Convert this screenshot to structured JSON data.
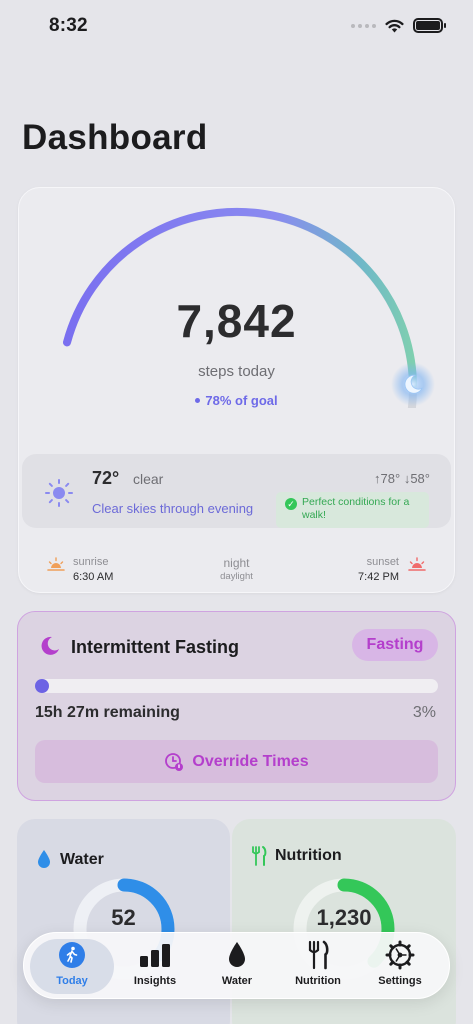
{
  "status_bar": {
    "time": "8:32"
  },
  "page": {
    "title": "Dashboard"
  },
  "steps": {
    "value": "7,842",
    "label": "steps today",
    "goal_text": "78% of goal",
    "goal_fraction": 0.78
  },
  "weather": {
    "temp": "72°",
    "condition": "clear",
    "high": "↑78°",
    "low": "↓58°",
    "forecast": "Clear skies through evening",
    "walk_badge": "Perfect conditions for a walk!"
  },
  "sun": {
    "sunrise_label": "sunrise",
    "sunrise_time": "6:30 AM",
    "mid_label": "night",
    "mid_sub": "daylight",
    "sunset_label": "sunset",
    "sunset_time": "7:42 PM"
  },
  "fasting": {
    "title": "Intermittent Fasting",
    "badge": "Fasting",
    "remaining": "15h 27m remaining",
    "percent": "3%",
    "progress_fraction": 0.03,
    "override_label": "Override Times"
  },
  "water": {
    "title": "Water",
    "value": "52",
    "progress_fraction": 0.35
  },
  "nutrition": {
    "title": "Nutrition",
    "value": "1,230",
    "progress_fraction": 0.38
  },
  "tabs": [
    {
      "label": "Today",
      "icon": "walk-icon",
      "active": true
    },
    {
      "label": "Insights",
      "icon": "bar-chart-icon",
      "active": false
    },
    {
      "label": "Water",
      "icon": "drop-icon",
      "active": false
    },
    {
      "label": "Nutrition",
      "icon": "fork-knife-icon",
      "active": false
    },
    {
      "label": "Settings",
      "icon": "gear-icon",
      "active": false
    }
  ],
  "colors": {
    "accent": "#6e6ae8",
    "fasting": "#b43fcc",
    "water": "#2f8ee8",
    "nutrition": "#34c759",
    "tab_active": "#2f7ee8"
  }
}
